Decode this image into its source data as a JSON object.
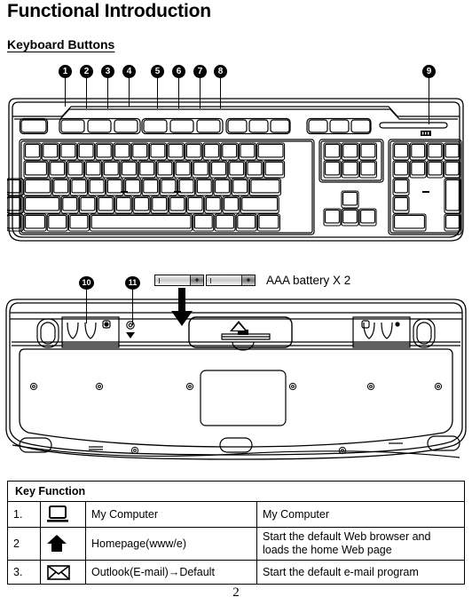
{
  "document": {
    "title": "Functional Introduction",
    "section_title": "Keyboard Buttons",
    "page_number": "2"
  },
  "callouts": {
    "top_view": [
      {
        "id": "1",
        "label": "1"
      },
      {
        "id": "2",
        "label": "2"
      },
      {
        "id": "3",
        "label": "3"
      },
      {
        "id": "4",
        "label": "4"
      },
      {
        "id": "5",
        "label": "5"
      },
      {
        "id": "6",
        "label": "6"
      },
      {
        "id": "7",
        "label": "7"
      },
      {
        "id": "8",
        "label": "8"
      },
      {
        "id": "9",
        "label": "9"
      }
    ],
    "bottom_view": [
      {
        "id": "10",
        "label": "10"
      },
      {
        "id": "11",
        "label": "11"
      }
    ]
  },
  "battery": {
    "label": "AAA battery X 2",
    "positive_terminal": "+",
    "count": 2
  },
  "key_function_table": {
    "header": "Key Function",
    "rows": [
      {
        "num": "1.",
        "icon": "monitor-icon",
        "name": "My Computer",
        "description": "My Computer",
        "justify": false
      },
      {
        "num": "2",
        "icon": "home-arrow-icon",
        "name": "Homepage(www/e)",
        "description": "Start the default Web browser and loads the home Web page",
        "justify": true
      },
      {
        "num": "3.",
        "icon": "envelope-icon",
        "name": "Outlook(E-mail)→Default",
        "description": "Start the default e-mail program",
        "justify": false
      }
    ]
  },
  "colors": {
    "ink": "#000000",
    "paper": "#ffffff",
    "battery_body": "#d9d9d9",
    "battery_cap": "#8e8e8e"
  }
}
